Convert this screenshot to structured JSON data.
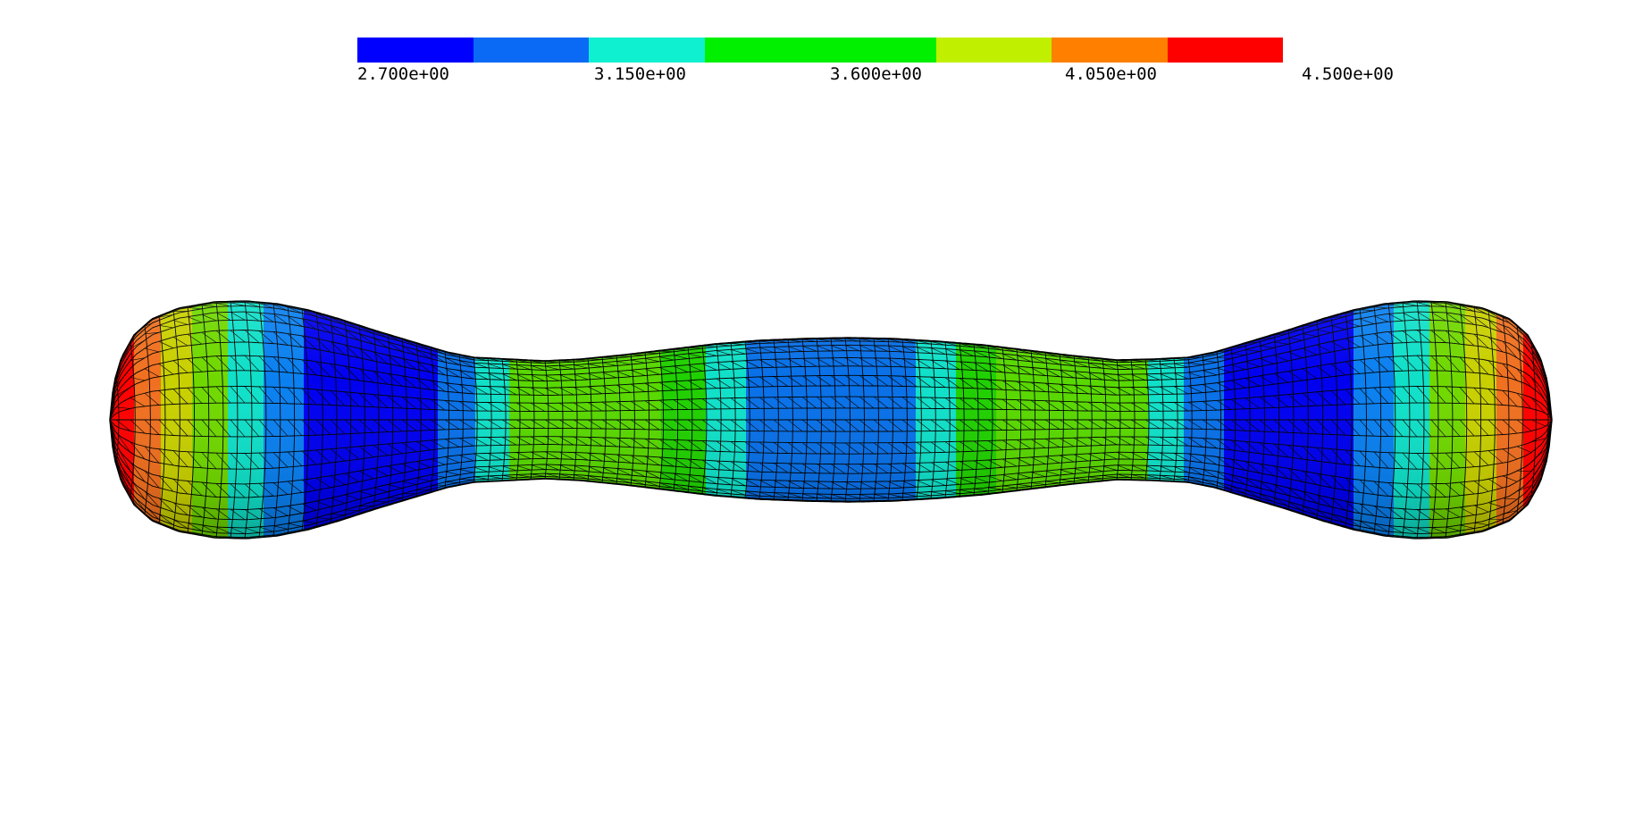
{
  "colorbar": {
    "colors": [
      "#0000ff",
      "#0a6af5",
      "#0ff0d0",
      "#00f000",
      "#00f000",
      "#c0f000",
      "#ff8000",
      "#ff0000"
    ],
    "min": 2.7,
    "max": 4.5,
    "tick_labels": [
      "2.700e+00",
      "3.150e+00",
      "3.600e+00",
      "4.050e+00",
      "4.500e+00"
    ]
  },
  "surface": {
    "mesh_line_color": "#000000",
    "band_colors": {
      "red": "#ff0000",
      "orange": "#f07020",
      "yellow": "#c8d000",
      "lime": "#70d800",
      "green": "#20d000",
      "cyan": "#00e0c0",
      "lightblue": "#0a80f0",
      "blue": "#0000f0",
      "midblue": "#0870e8",
      "aqua": "#10e0c8",
      "lgreen": "#58d800"
    }
  }
}
